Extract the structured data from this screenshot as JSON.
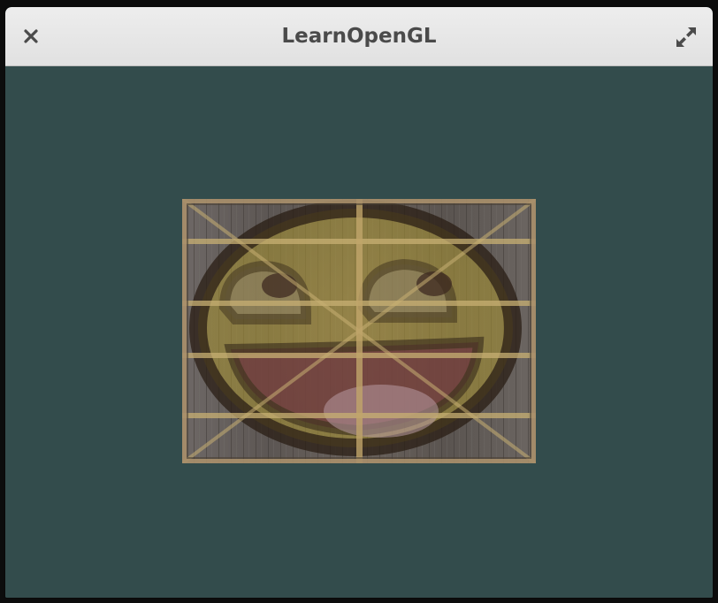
{
  "window": {
    "title": "LearnOpenGL",
    "clear_color": "#334c4c"
  },
  "titlebar": {
    "close_icon": "close-icon",
    "maximize_icon": "maximize-icon"
  },
  "scene": {
    "textures": [
      "wooden-container",
      "awesomeface"
    ],
    "blend": "mixed"
  }
}
